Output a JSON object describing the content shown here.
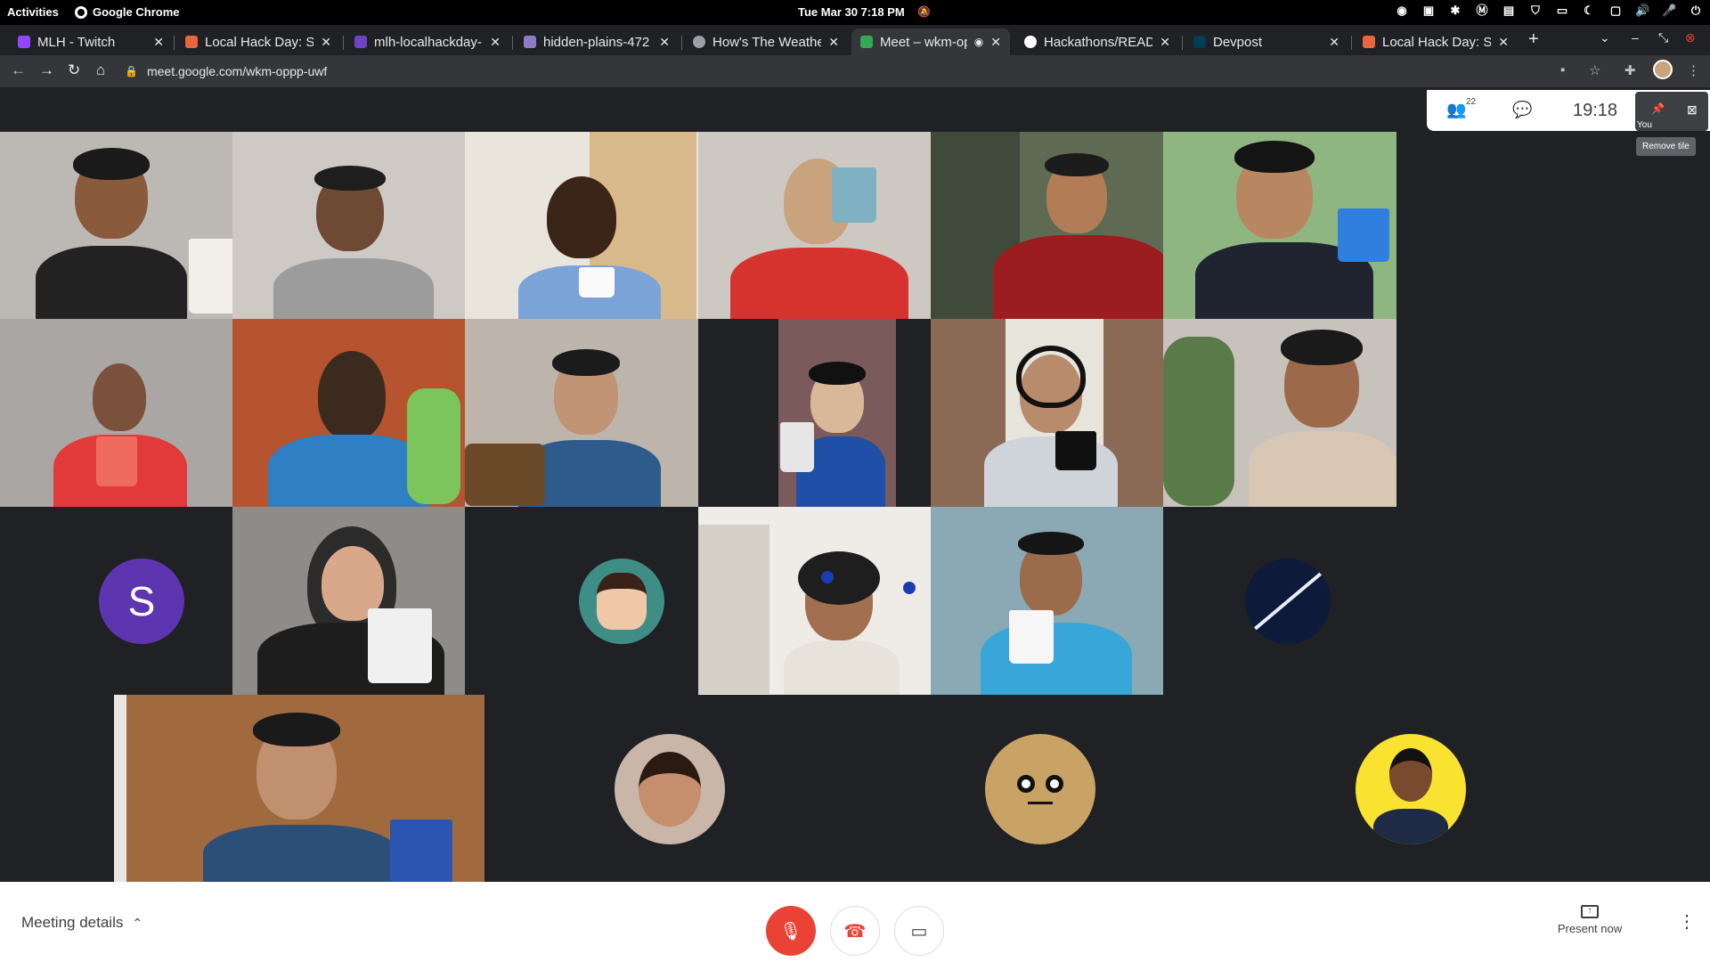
{
  "gnome": {
    "activities": "Activities",
    "app_name": "Google Chrome",
    "clock": "Tue Mar 30   7:18 PM"
  },
  "tabs": [
    {
      "title": "MLH - Twitch",
      "color": "#9146ff"
    },
    {
      "title": "Local Hack Day: Sh",
      "color": "#e8663d"
    },
    {
      "title": "mlh-localhackday-",
      "color": "#6f42c1"
    },
    {
      "title": "hidden-plains-472",
      "color": "#8e7cc3"
    },
    {
      "title": "How's The Weathe",
      "color": "#9aa0a6"
    },
    {
      "title": "Meet – wkm-op",
      "color": "#34a853",
      "active": true
    },
    {
      "title": "Hackathons/READI",
      "color": "#ffffff"
    },
    {
      "title": "Devpost",
      "color": "#003e54"
    },
    {
      "title": "Local Hack Day: Sh",
      "color": "#e8663d"
    }
  ],
  "toolbar": {
    "url": "meet.google.com/wkm-oppp-uwf"
  },
  "meet": {
    "participant_count": "22",
    "time": "19:18",
    "self_label": "You",
    "tooltip": "Remove tile",
    "avatar_letter": "S",
    "meeting_details": "Meeting details",
    "present_now": "Present now"
  },
  "colors": {
    "mic_off_red": "#ea4335",
    "avatar_purple": "#5e35b1",
    "avatar_yellow": "#f9e230"
  }
}
